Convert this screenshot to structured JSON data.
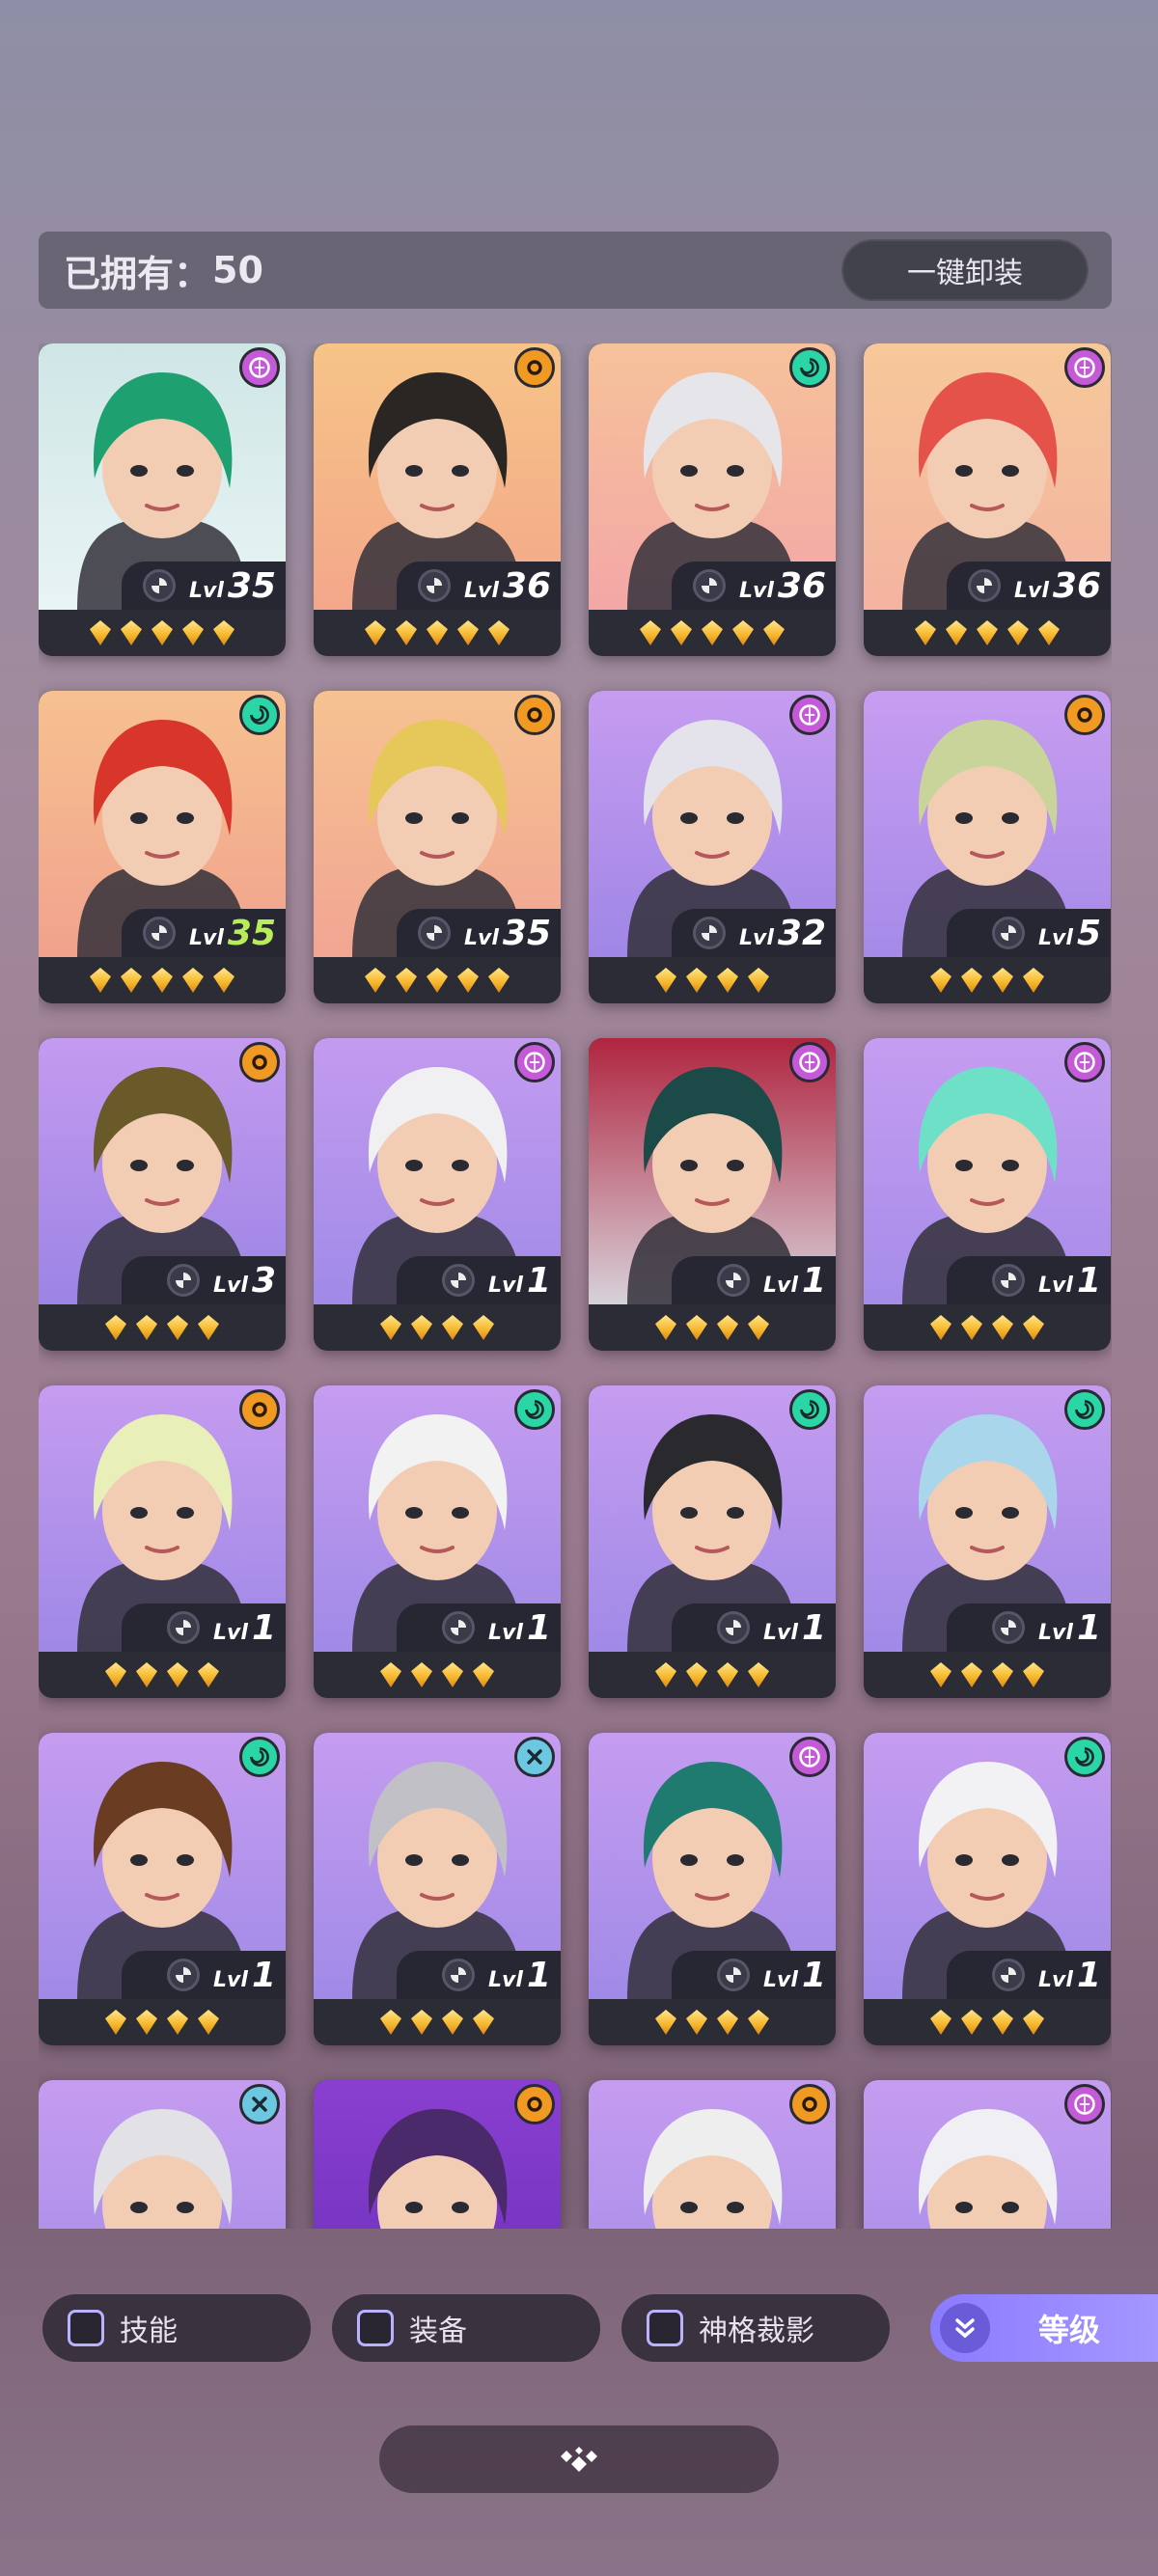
{
  "header": {
    "owned_label": "已拥有：",
    "owned_count": "50",
    "unequip_label": "一键卸装"
  },
  "filters": {
    "skill": "技能",
    "equip": "装备",
    "shadow": "神格裁影",
    "level": "等级"
  },
  "colors": {
    "accent": "#8b7bff",
    "card_bg": "#2b2c36",
    "gem": "#f6b62b"
  },
  "heroes": [
    {
      "faction": "void",
      "level": "35",
      "stars": 5,
      "bg": [
        "#cfe6e6",
        "#e9f4f4"
      ],
      "hair": "#1fa070"
    },
    {
      "faction": "sun",
      "level": "36",
      "stars": 5,
      "bg": [
        "#f6c487",
        "#f4a78a"
      ],
      "hair": "#2a2624"
    },
    {
      "faction": "swirl",
      "level": "36",
      "stars": 5,
      "bg": [
        "#f6c29a",
        "#f3a7a7"
      ],
      "hair": "#e6e6ea"
    },
    {
      "faction": "void",
      "level": "36",
      "stars": 5,
      "bg": [
        "#f6c89a",
        "#f4b3a0"
      ],
      "hair": "#e4524a"
    },
    {
      "faction": "swirl",
      "level": "35",
      "stars": 5,
      "bg": [
        "#f6c190",
        "#f1a28d"
      ],
      "hair": "#d8362a",
      "green": true
    },
    {
      "faction": "sun",
      "level": "35",
      "stars": 5,
      "bg": [
        "#f6c291",
        "#f1a592"
      ],
      "hair": "#e6c85a"
    },
    {
      "faction": "void",
      "level": "32",
      "stars": 4,
      "bg": [
        "#c69cf0",
        "#9f86e6"
      ],
      "hair": "#e4e2ea"
    },
    {
      "faction": "sun",
      "level": "5",
      "stars": 4,
      "bg": [
        "#c79df1",
        "#a58ae8"
      ],
      "hair": "#c8d49a"
    },
    {
      "faction": "sun",
      "level": "3",
      "stars": 4,
      "bg": [
        "#c49bf0",
        "#9c84e4"
      ],
      "hair": "#6a5a2a"
    },
    {
      "faction": "void",
      "level": "1",
      "stars": 4,
      "bg": [
        "#c39bef",
        "#a08ae8"
      ],
      "hair": "#f0f0f2"
    },
    {
      "faction": "void",
      "level": "1",
      "stars": 4,
      "bg": [
        "#b02540",
        "#d7d2da"
      ],
      "hair": "#1c4a48"
    },
    {
      "faction": "void",
      "level": "1",
      "stars": 4,
      "bg": [
        "#c59df1",
        "#a58ce9"
      ],
      "hair": "#6fe0c8"
    },
    {
      "faction": "sun",
      "level": "1",
      "stars": 4,
      "bg": [
        "#c59cf0",
        "#9f88e6"
      ],
      "hair": "#e8efb8"
    },
    {
      "faction": "swirl",
      "level": "1",
      "stars": 4,
      "bg": [
        "#c59cf0",
        "#a08ae7"
      ],
      "hair": "#f2f2f2"
    },
    {
      "faction": "swirl",
      "level": "1",
      "stars": 4,
      "bg": [
        "#c59cf0",
        "#a08ae7"
      ],
      "hair": "#2a2a2e"
    },
    {
      "faction": "swirl",
      "level": "1",
      "stars": 4,
      "bg": [
        "#c59cf0",
        "#a08ae7"
      ],
      "hair": "#a9d6ea"
    },
    {
      "faction": "swirl",
      "level": "1",
      "stars": 4,
      "bg": [
        "#c59cf0",
        "#a08ae7"
      ],
      "hair": "#6a3c22"
    },
    {
      "faction": "cross",
      "level": "1",
      "stars": 4,
      "bg": [
        "#c59cf0",
        "#a08ae7"
      ],
      "hair": "#c0c0c6"
    },
    {
      "faction": "void",
      "level": "1",
      "stars": 4,
      "bg": [
        "#c59cf0",
        "#a08ae7"
      ],
      "hair": "#1f7a70"
    },
    {
      "faction": "swirl",
      "level": "1",
      "stars": 4,
      "bg": [
        "#c59cf0",
        "#a08ae7"
      ],
      "hair": "#f2f2f4"
    },
    {
      "faction": "cross",
      "level": "",
      "stars": 0,
      "bg": [
        "#c59cf0",
        "#a08ae7"
      ],
      "hair": "#e2e2e6"
    },
    {
      "faction": "sun",
      "level": "",
      "stars": 0,
      "bg": [
        "#8a3fd0",
        "#6a2eb8"
      ],
      "hair": "#4a2a6a"
    },
    {
      "faction": "sun",
      "level": "",
      "stars": 0,
      "bg": [
        "#c59cf0",
        "#a08ae7"
      ],
      "hair": "#eeeeee"
    },
    {
      "faction": "void",
      "level": "",
      "stars": 0,
      "bg": [
        "#c59cf0",
        "#a08ae7"
      ],
      "hair": "#f0f0f4"
    }
  ],
  "faction_colors": {
    "void": "#c45ad8",
    "sun": "#f09a24",
    "swirl": "#2bd6a6",
    "cross": "#6cc8e0"
  }
}
